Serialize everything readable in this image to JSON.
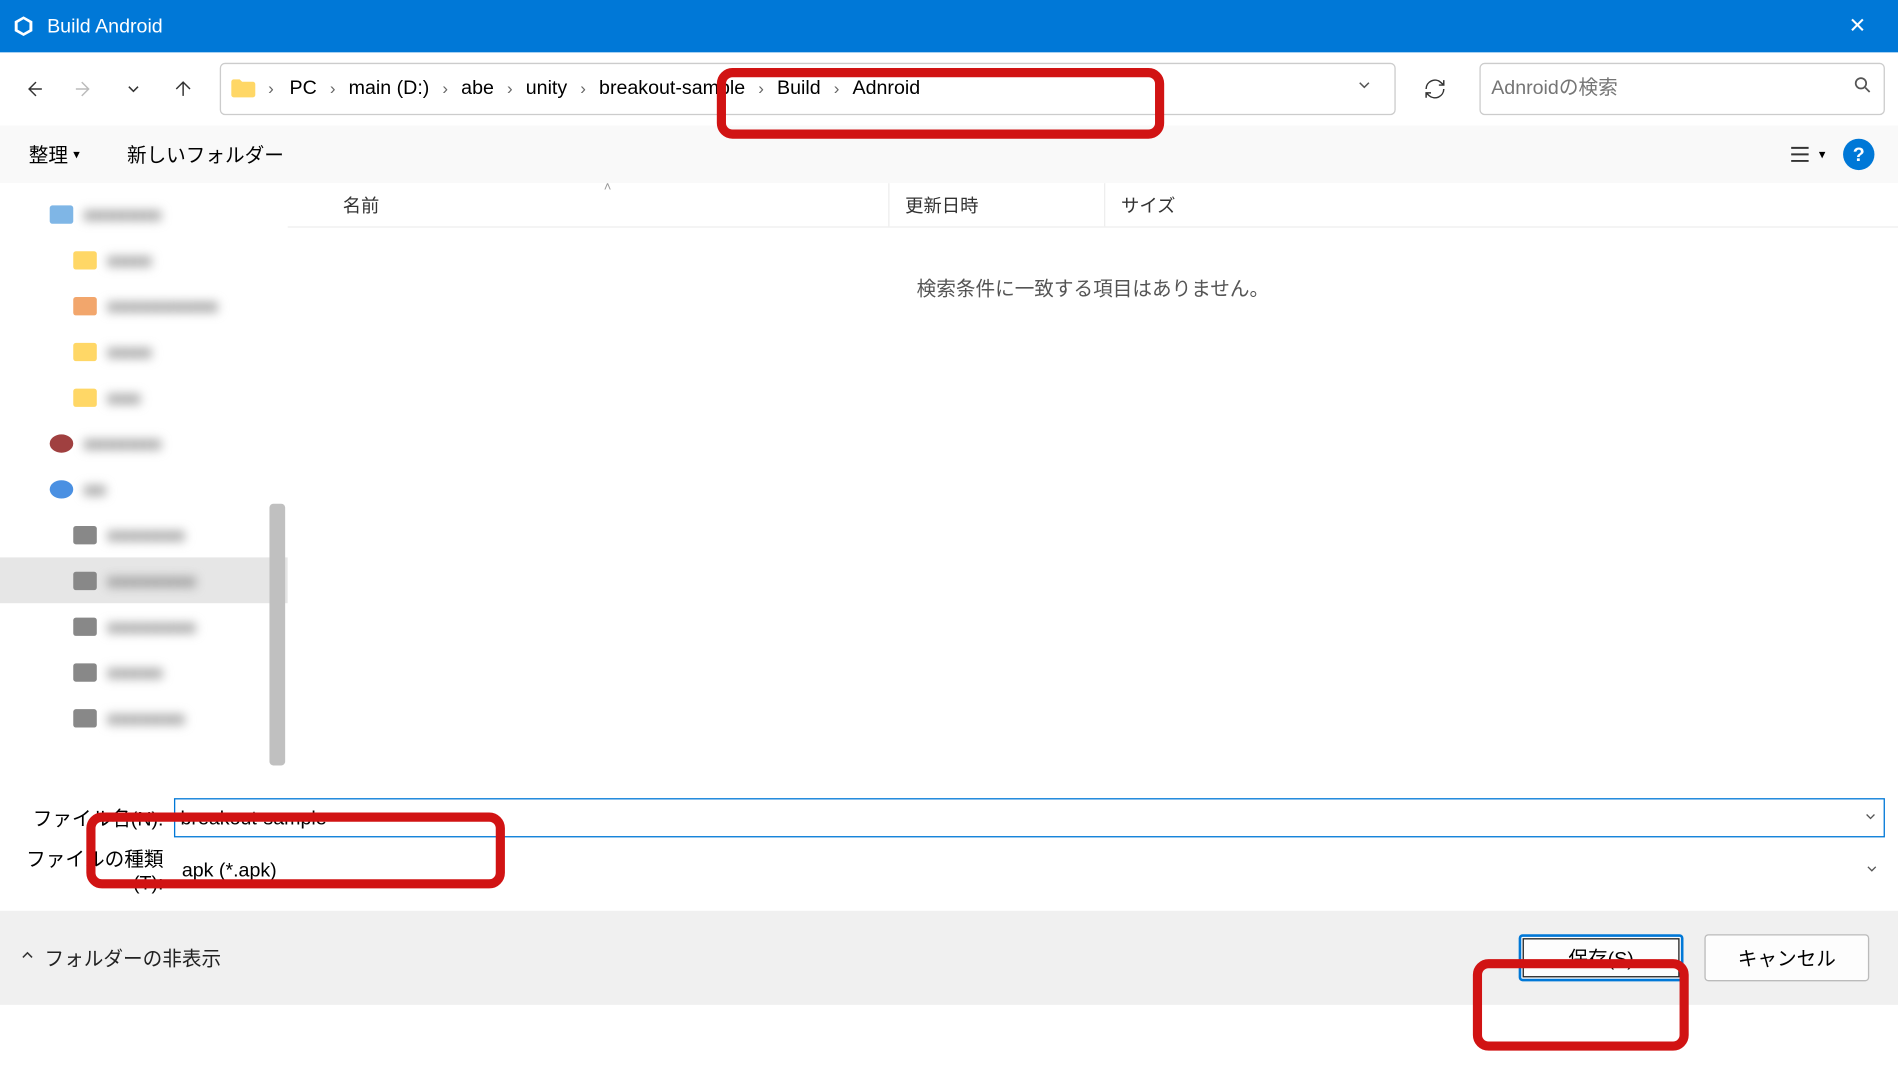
{
  "title": "Build Android",
  "breadcrumb": [
    "PC",
    "main (D:)",
    "abe",
    "unity",
    "breakout-sample",
    "Build",
    "Adnroid"
  ],
  "search": {
    "placeholder": "Adnroidの検索"
  },
  "toolbar": {
    "organize": "整理",
    "newfolder": "新しいフォルダー"
  },
  "columns": {
    "name": "名前",
    "date": "更新日時",
    "size": "サイズ"
  },
  "empty_message": "検索条件に一致する項目はありません。",
  "fields": {
    "filename_label": "ファイル名(N):",
    "filetype_label": "ファイルの種類(T):",
    "filename_value": "breakout-sample",
    "filetype_value": "apk (*.apk)"
  },
  "footer": {
    "hide_folders": "フォルダーの非表示",
    "save": "保存(S)",
    "cancel": "キャンセル"
  },
  "icons": {
    "close": "✕",
    "chevron_right": "›",
    "chevron_down": "⌄",
    "chevron_up": "˄",
    "caret_down": "▾",
    "search": "🔍",
    "help": "?"
  }
}
